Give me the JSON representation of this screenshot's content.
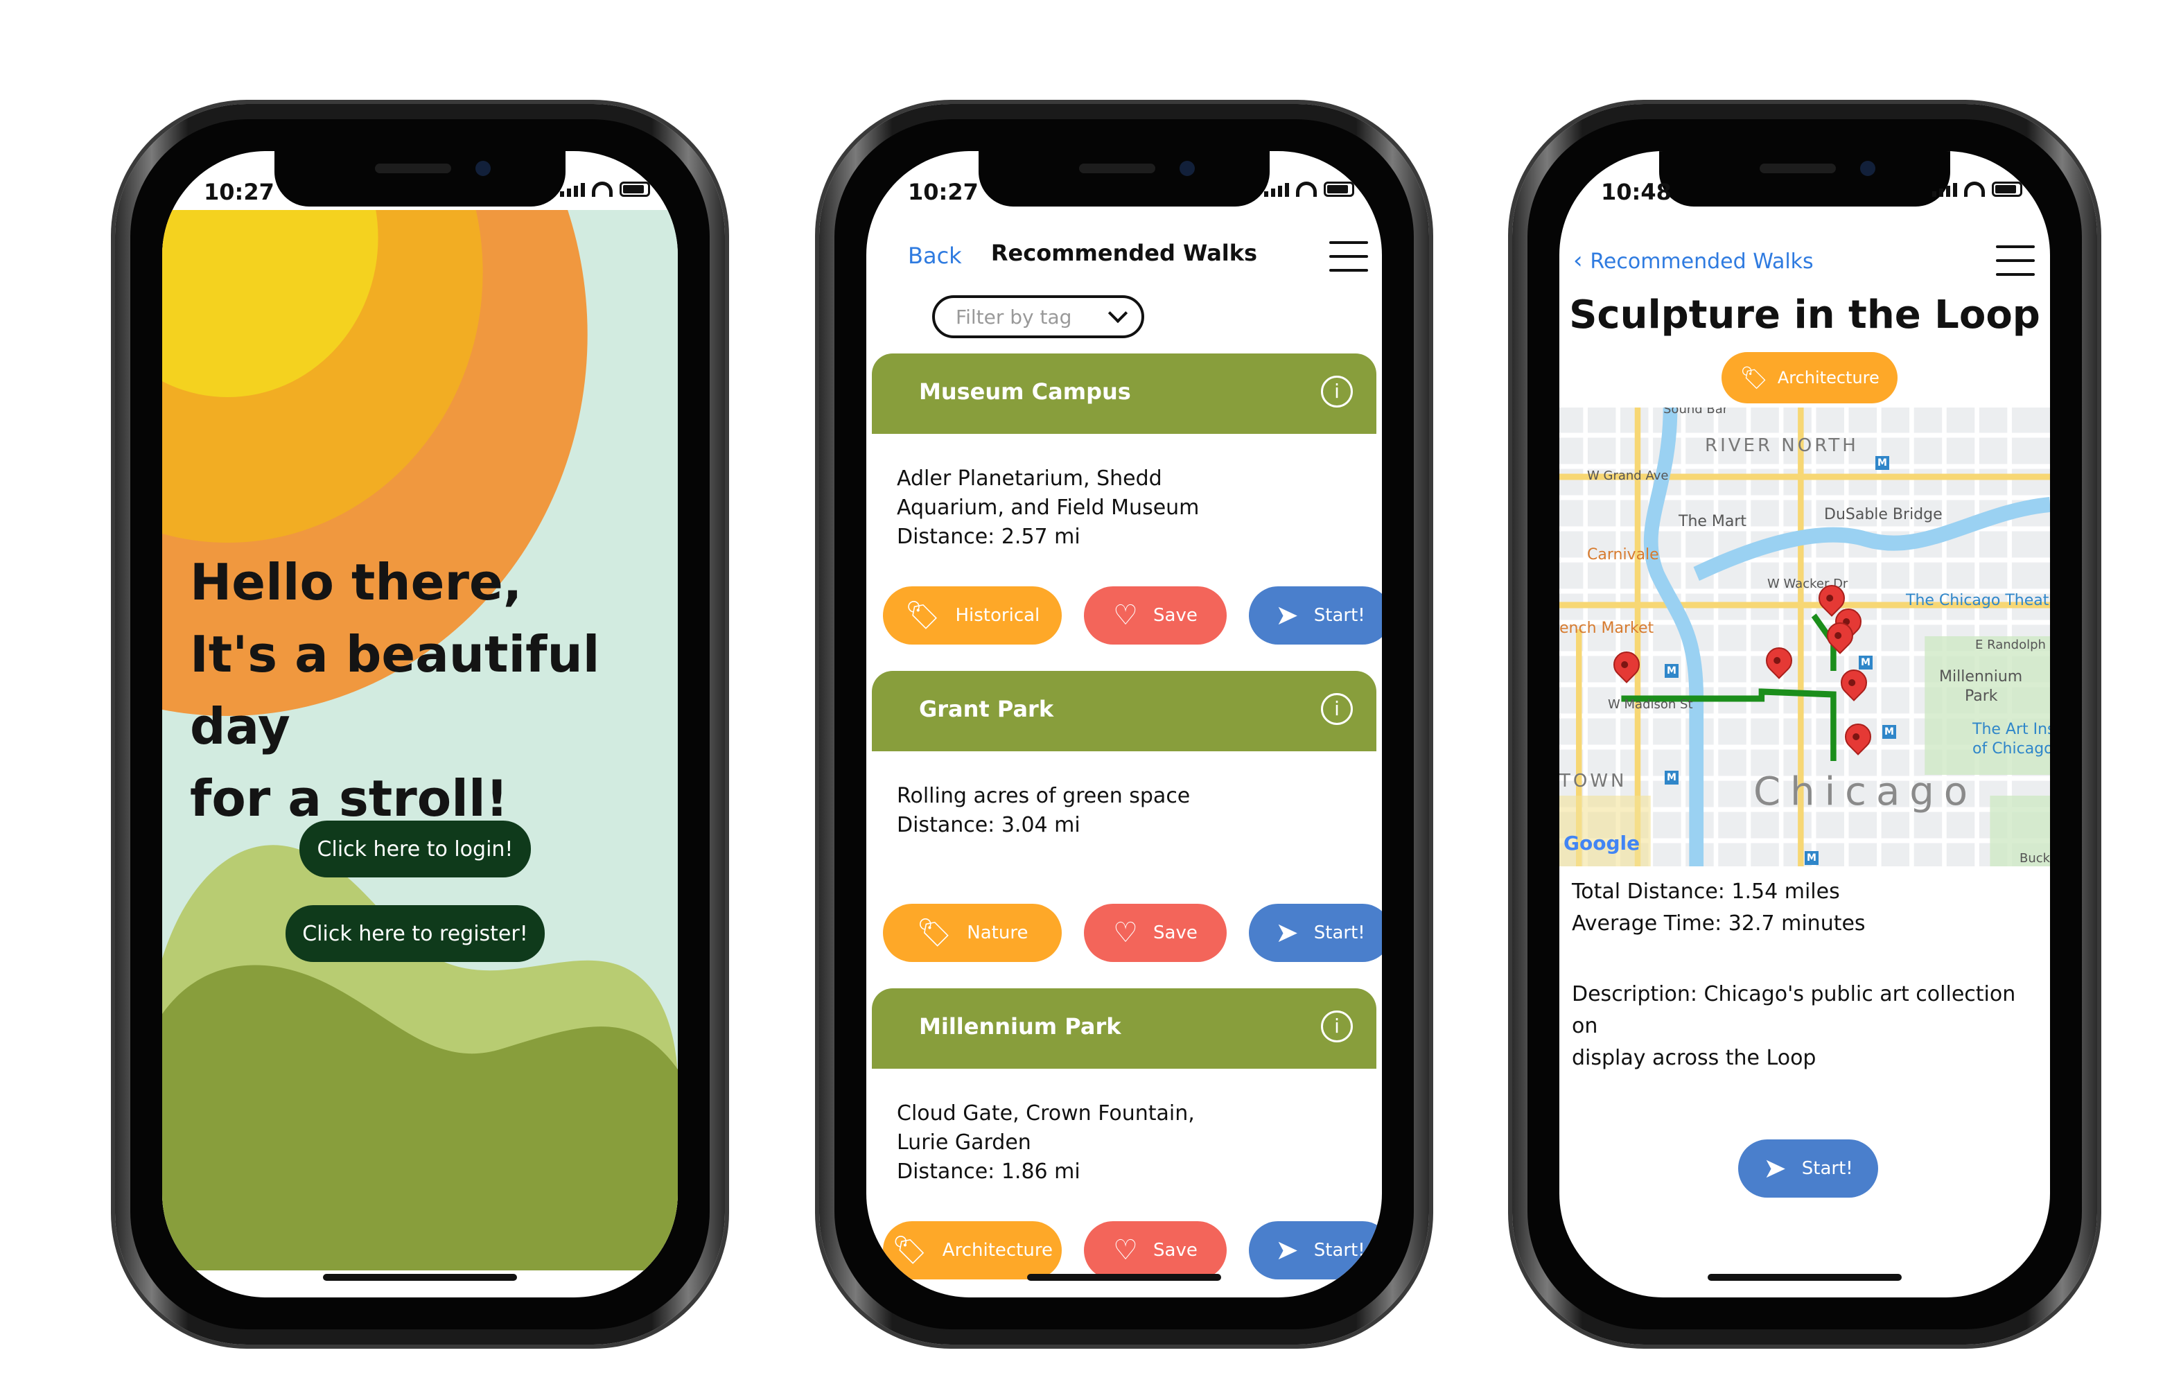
{
  "phone1": {
    "status_time": "10:27",
    "greeting_line1": "Hello there,",
    "greeting_line2": "It's a beautiful day",
    "greeting_line3": "for a stroll!",
    "login_label": "Click here to login!",
    "register_label": "Click here to register!",
    "colors": {
      "sky": "#d2ebe0",
      "sun_core": "#f4d21f",
      "sun_mid": "#f2ad23",
      "sun_outer": "#f0983f",
      "hill_light": "#b8cc72",
      "hill_dark": "#889e3c",
      "button": "#0f3a1b"
    }
  },
  "phone2": {
    "status_time": "10:27",
    "back_label": "Back",
    "title": "Recommended Walks",
    "menu_icon": "hamburger-menu-icon",
    "filter_placeholder": "Filter by tag",
    "walks": [
      {
        "name": "Museum Campus",
        "desc_line1": "Adler Planetarium, Shedd",
        "desc_line2": "Aquarium, and Field Museum",
        "distance": "Distance: 2.57 mi",
        "tag": "Historical",
        "save": "Save",
        "start": "Start!"
      },
      {
        "name": "Grant Park",
        "desc_line1": "Rolling acres of green space",
        "desc_line2": "",
        "distance": "Distance: 3.04 mi",
        "tag": "Nature",
        "save": "Save",
        "start": "Start!"
      },
      {
        "name": "Millennium Park",
        "desc_line1": "Cloud Gate, Crown Fountain,",
        "desc_line2": "Lurie Garden",
        "distance": "Distance: 1.86 mi",
        "tag": "Architecture",
        "save": "Save",
        "start": "Start!"
      }
    ],
    "colors": {
      "card_header": "#889e3c",
      "tag_button": "#fea828",
      "save_button": "#f3655a",
      "start_button": "#4a7fcc",
      "link": "#2f7be0"
    }
  },
  "phone3": {
    "status_time": "10:48",
    "back_label": "Recommended Walks",
    "title": "Sculpture in the Loop",
    "tag": "Architecture",
    "map": {
      "labels": {
        "river_north": "RIVER NORTH",
        "grand": "W Grand Ave",
        "mart": "The Mart",
        "dusable": "DuSable Bridge",
        "carnivale": "Carnivale",
        "wacker": "W Wacker Dr",
        "chicago_theatre": "The Chicago Theatre",
        "french_market": "ench Market",
        "randolph": "E Randolph St",
        "millennium": "Millennium",
        "park": "Park",
        "madison": "W Madison St",
        "art_inst": "The Art Instit",
        "of_chicago": "of Chicago",
        "town": "TOWN",
        "chicago": "Chicago",
        "google": "Google",
        "buckingham": "Buckingh",
        "south_bar": "Sound Bar"
      }
    },
    "total_distance": "Total Distance: 1.54 miles",
    "average_time": "Average Time: 32.7 minutes",
    "description_line1": "Description: Chicago's public art collection on",
    "description_line2": "display across the Loop",
    "start": "Start!"
  }
}
